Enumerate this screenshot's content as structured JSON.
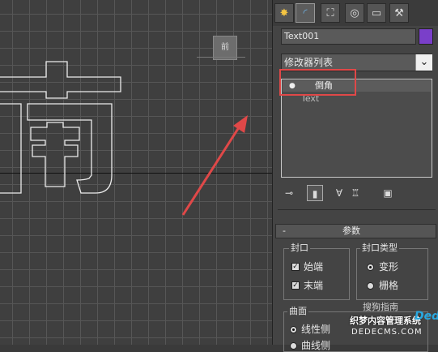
{
  "viewport": {
    "viewcube_label": "前"
  },
  "panel": {
    "tabs": [
      {
        "icon": "create-tab-icon"
      },
      {
        "icon": "modify-tab-icon"
      },
      {
        "icon": "hierarchy-tab-icon"
      },
      {
        "icon": "motion-tab-icon"
      },
      {
        "icon": "display-tab-icon"
      },
      {
        "icon": "utilities-tab-icon"
      }
    ],
    "object_name": "Text001",
    "object_color": "#7a3fc9",
    "modifier_list_label": "修改器列表",
    "stack": {
      "items": [
        {
          "label": "倒角",
          "selected": true
        },
        {
          "label": "Text",
          "selected": false
        }
      ]
    },
    "rollout": {
      "title": "参数",
      "collapse_symbol": "-",
      "cap_group": {
        "title": "封口",
        "start_label": "始端",
        "end_label": "末端",
        "start_checked": true,
        "end_checked": true
      },
      "cap_type_group": {
        "title": "封口类型",
        "morph_label": "变形",
        "grid_label": "栅格",
        "selected": "变形"
      },
      "surface_group": {
        "title": "曲面",
        "linear_label": "线性侧",
        "curved_label": "曲线侧"
      }
    }
  },
  "watermark": {
    "top": "搜狗指南",
    "main": "织梦内容管理系统",
    "url": "DEDECMS.COM",
    "logo": "Dede"
  },
  "colors": {
    "highlight_box": "#e04848",
    "arrow": "#e04848"
  }
}
